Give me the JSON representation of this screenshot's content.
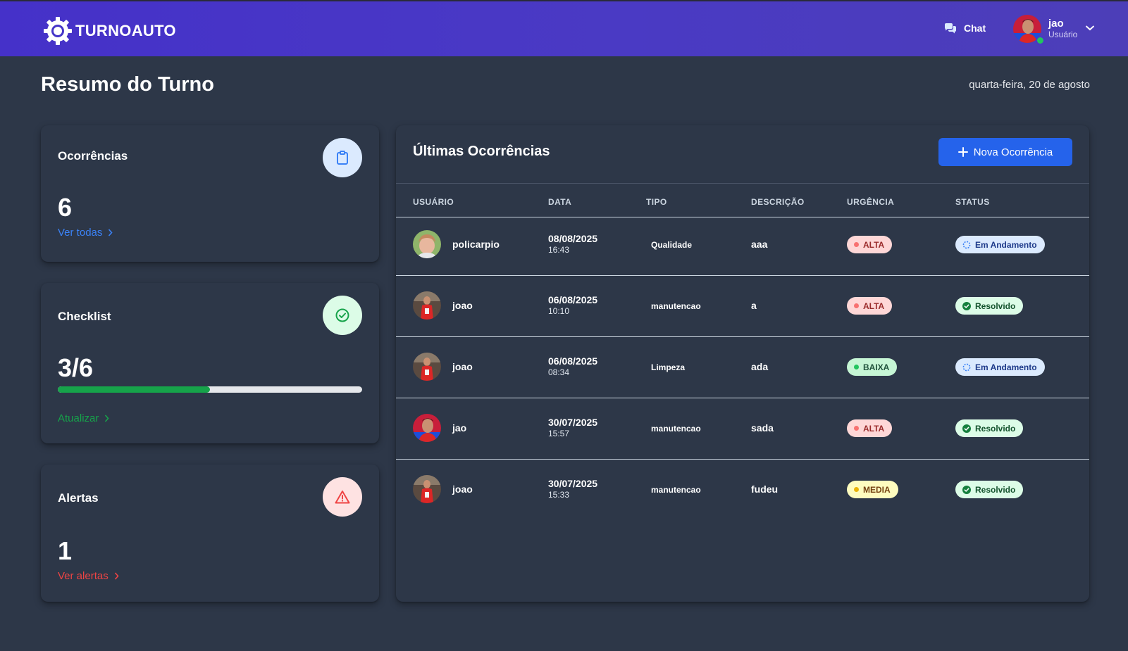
{
  "brand": {
    "name": "TURNOAUTO"
  },
  "nav": {
    "chat_label": "Chat",
    "user_name": "jao",
    "user_role": "Usuário"
  },
  "page": {
    "title": "Resumo do Turno",
    "date": "quarta-feira, 20 de agosto"
  },
  "cards": {
    "occurrences": {
      "title": "Ocorrências",
      "value": "6",
      "link": "Ver todas",
      "icon": "clipboard-icon",
      "accent": "#3b82f6"
    },
    "checklist": {
      "title": "Checklist",
      "value": "3/6",
      "progress": 0.5,
      "link": "Atualizar",
      "icon": "check-circle-icon",
      "accent": "#16a34a"
    },
    "alerts": {
      "title": "Alertas",
      "value": "1",
      "link": "Ver alertas",
      "icon": "alert-triangle-icon",
      "accent": "#ef4444"
    }
  },
  "table": {
    "title": "Últimas Ocorrências",
    "new_button": "Nova Ocorrência",
    "headers": [
      "USUÁRIO",
      "DATA",
      "TIPO",
      "DESCRIÇÃO",
      "URGÊNCIA",
      "STATUS"
    ],
    "rows": [
      {
        "user": "policarpio",
        "avatar": "avatar-kid",
        "date": "08/08/2025",
        "time": "16:43",
        "type": "Qualidade",
        "desc": "aaa",
        "urgency": "ALTA",
        "status": "Em Andamento"
      },
      {
        "user": "joao",
        "avatar": "avatar-player",
        "date": "06/08/2025",
        "time": "10:10",
        "type": "manutencao",
        "desc": "a",
        "urgency": "ALTA",
        "status": "Resolvido"
      },
      {
        "user": "joao",
        "avatar": "avatar-player",
        "date": "06/08/2025",
        "time": "08:34",
        "type": "Limpeza",
        "desc": "ada",
        "urgency": "BAIXA",
        "status": "Em Andamento"
      },
      {
        "user": "jao",
        "avatar": "avatar-red",
        "date": "30/07/2025",
        "time": "15:57",
        "type": "manutencao",
        "desc": "sada",
        "urgency": "ALTA",
        "status": "Resolvido"
      },
      {
        "user": "joao",
        "avatar": "avatar-player",
        "date": "30/07/2025",
        "time": "15:33",
        "type": "manutencao",
        "desc": "fudeu",
        "urgency": "MEDIA",
        "status": "Resolvido"
      }
    ]
  },
  "colors": {
    "navbar": "#4a3ac4",
    "background": "#2d3748",
    "primary_button": "#2563eb"
  }
}
